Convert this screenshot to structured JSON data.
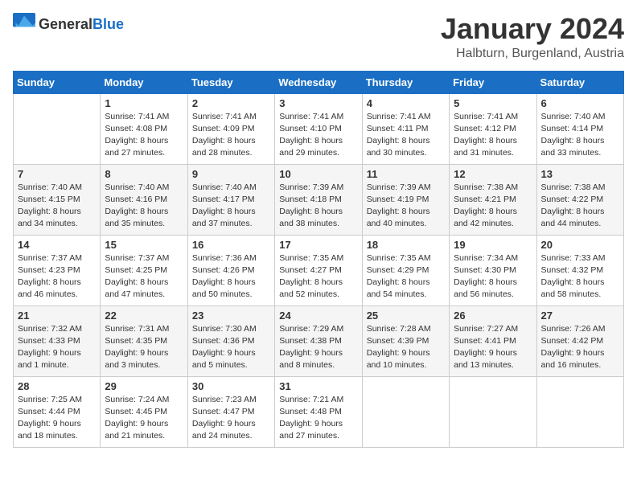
{
  "header": {
    "logo_general": "General",
    "logo_blue": "Blue",
    "month_title": "January 2024",
    "location": "Halbturn, Burgenland, Austria"
  },
  "columns": [
    "Sunday",
    "Monday",
    "Tuesday",
    "Wednesday",
    "Thursday",
    "Friday",
    "Saturday"
  ],
  "weeks": [
    [
      {
        "day": "",
        "sunrise": "",
        "sunset": "",
        "daylight": ""
      },
      {
        "day": "1",
        "sunrise": "Sunrise: 7:41 AM",
        "sunset": "Sunset: 4:08 PM",
        "daylight": "Daylight: 8 hours and 27 minutes."
      },
      {
        "day": "2",
        "sunrise": "Sunrise: 7:41 AM",
        "sunset": "Sunset: 4:09 PM",
        "daylight": "Daylight: 8 hours and 28 minutes."
      },
      {
        "day": "3",
        "sunrise": "Sunrise: 7:41 AM",
        "sunset": "Sunset: 4:10 PM",
        "daylight": "Daylight: 8 hours and 29 minutes."
      },
      {
        "day": "4",
        "sunrise": "Sunrise: 7:41 AM",
        "sunset": "Sunset: 4:11 PM",
        "daylight": "Daylight: 8 hours and 30 minutes."
      },
      {
        "day": "5",
        "sunrise": "Sunrise: 7:41 AM",
        "sunset": "Sunset: 4:12 PM",
        "daylight": "Daylight: 8 hours and 31 minutes."
      },
      {
        "day": "6",
        "sunrise": "Sunrise: 7:40 AM",
        "sunset": "Sunset: 4:14 PM",
        "daylight": "Daylight: 8 hours and 33 minutes."
      }
    ],
    [
      {
        "day": "7",
        "sunrise": "Sunrise: 7:40 AM",
        "sunset": "Sunset: 4:15 PM",
        "daylight": "Daylight: 8 hours and 34 minutes."
      },
      {
        "day": "8",
        "sunrise": "Sunrise: 7:40 AM",
        "sunset": "Sunset: 4:16 PM",
        "daylight": "Daylight: 8 hours and 35 minutes."
      },
      {
        "day": "9",
        "sunrise": "Sunrise: 7:40 AM",
        "sunset": "Sunset: 4:17 PM",
        "daylight": "Daylight: 8 hours and 37 minutes."
      },
      {
        "day": "10",
        "sunrise": "Sunrise: 7:39 AM",
        "sunset": "Sunset: 4:18 PM",
        "daylight": "Daylight: 8 hours and 38 minutes."
      },
      {
        "day": "11",
        "sunrise": "Sunrise: 7:39 AM",
        "sunset": "Sunset: 4:19 PM",
        "daylight": "Daylight: 8 hours and 40 minutes."
      },
      {
        "day": "12",
        "sunrise": "Sunrise: 7:38 AM",
        "sunset": "Sunset: 4:21 PM",
        "daylight": "Daylight: 8 hours and 42 minutes."
      },
      {
        "day": "13",
        "sunrise": "Sunrise: 7:38 AM",
        "sunset": "Sunset: 4:22 PM",
        "daylight": "Daylight: 8 hours and 44 minutes."
      }
    ],
    [
      {
        "day": "14",
        "sunrise": "Sunrise: 7:37 AM",
        "sunset": "Sunset: 4:23 PM",
        "daylight": "Daylight: 8 hours and 46 minutes."
      },
      {
        "day": "15",
        "sunrise": "Sunrise: 7:37 AM",
        "sunset": "Sunset: 4:25 PM",
        "daylight": "Daylight: 8 hours and 47 minutes."
      },
      {
        "day": "16",
        "sunrise": "Sunrise: 7:36 AM",
        "sunset": "Sunset: 4:26 PM",
        "daylight": "Daylight: 8 hours and 50 minutes."
      },
      {
        "day": "17",
        "sunrise": "Sunrise: 7:35 AM",
        "sunset": "Sunset: 4:27 PM",
        "daylight": "Daylight: 8 hours and 52 minutes."
      },
      {
        "day": "18",
        "sunrise": "Sunrise: 7:35 AM",
        "sunset": "Sunset: 4:29 PM",
        "daylight": "Daylight: 8 hours and 54 minutes."
      },
      {
        "day": "19",
        "sunrise": "Sunrise: 7:34 AM",
        "sunset": "Sunset: 4:30 PM",
        "daylight": "Daylight: 8 hours and 56 minutes."
      },
      {
        "day": "20",
        "sunrise": "Sunrise: 7:33 AM",
        "sunset": "Sunset: 4:32 PM",
        "daylight": "Daylight: 8 hours and 58 minutes."
      }
    ],
    [
      {
        "day": "21",
        "sunrise": "Sunrise: 7:32 AM",
        "sunset": "Sunset: 4:33 PM",
        "daylight": "Daylight: 9 hours and 1 minute."
      },
      {
        "day": "22",
        "sunrise": "Sunrise: 7:31 AM",
        "sunset": "Sunset: 4:35 PM",
        "daylight": "Daylight: 9 hours and 3 minutes."
      },
      {
        "day": "23",
        "sunrise": "Sunrise: 7:30 AM",
        "sunset": "Sunset: 4:36 PM",
        "daylight": "Daylight: 9 hours and 5 minutes."
      },
      {
        "day": "24",
        "sunrise": "Sunrise: 7:29 AM",
        "sunset": "Sunset: 4:38 PM",
        "daylight": "Daylight: 9 hours and 8 minutes."
      },
      {
        "day": "25",
        "sunrise": "Sunrise: 7:28 AM",
        "sunset": "Sunset: 4:39 PM",
        "daylight": "Daylight: 9 hours and 10 minutes."
      },
      {
        "day": "26",
        "sunrise": "Sunrise: 7:27 AM",
        "sunset": "Sunset: 4:41 PM",
        "daylight": "Daylight: 9 hours and 13 minutes."
      },
      {
        "day": "27",
        "sunrise": "Sunrise: 7:26 AM",
        "sunset": "Sunset: 4:42 PM",
        "daylight": "Daylight: 9 hours and 16 minutes."
      }
    ],
    [
      {
        "day": "28",
        "sunrise": "Sunrise: 7:25 AM",
        "sunset": "Sunset: 4:44 PM",
        "daylight": "Daylight: 9 hours and 18 minutes."
      },
      {
        "day": "29",
        "sunrise": "Sunrise: 7:24 AM",
        "sunset": "Sunset: 4:45 PM",
        "daylight": "Daylight: 9 hours and 21 minutes."
      },
      {
        "day": "30",
        "sunrise": "Sunrise: 7:23 AM",
        "sunset": "Sunset: 4:47 PM",
        "daylight": "Daylight: 9 hours and 24 minutes."
      },
      {
        "day": "31",
        "sunrise": "Sunrise: 7:21 AM",
        "sunset": "Sunset: 4:48 PM",
        "daylight": "Daylight: 9 hours and 27 minutes."
      },
      {
        "day": "",
        "sunrise": "",
        "sunset": "",
        "daylight": ""
      },
      {
        "day": "",
        "sunrise": "",
        "sunset": "",
        "daylight": ""
      },
      {
        "day": "",
        "sunrise": "",
        "sunset": "",
        "daylight": ""
      }
    ]
  ]
}
